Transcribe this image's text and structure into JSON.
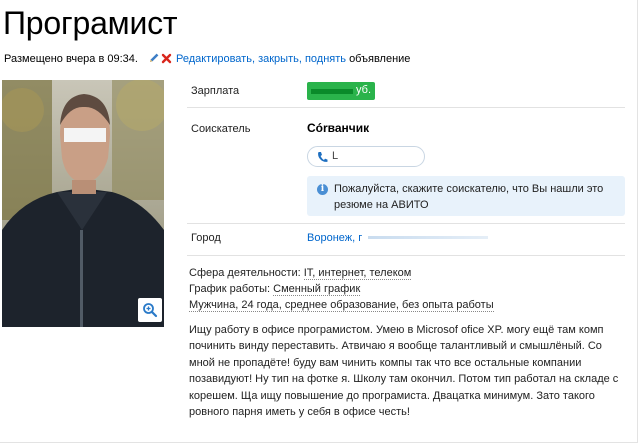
{
  "ad": {
    "title": "Програмист",
    "posted": "Размещено вчера в 09:34.",
    "actions": {
      "edit_close_raise": "Редактировать, закрыть, поднять",
      "object": "объявление"
    }
  },
  "fields": {
    "salary_label": "Зарплата",
    "salary_suffix": "уб.",
    "seeker_label": "Соискатель",
    "seeker_name": "Córванчик",
    "phone_partial": "L",
    "notice": "Пожалуйста, скажите соискателю, что Вы нашли это резюме на АВИТО",
    "city_label": "Город",
    "city_value": "Воронеж, г"
  },
  "details": {
    "sphere_label": "Сфера деятельности:",
    "sphere_value": "IT, интернет, телеком",
    "schedule_label": "График работы:",
    "schedule_value": "Сменный график",
    "person": "Мужчина, 24 года, среднее образование, без опыта работы"
  },
  "description": "Ищу работу в офисе програмистом. Умею в Microsof ofice XP. могу ещё там комп починить винду переставить. Атвичаю я вообще талантливый и смышлёный. Со мной не пропадёте! буду вам чинить компы так что все остальные компании позавидуют! Ну тип на фотке я. Школу там окончил. Потом тип работал на складе с корешем. Ща ищу повышение до програмиста. Двацатка минимум. Зато такого ровного парня иметь у себя в офисе честь!",
  "colors": {
    "link": "#0066cc",
    "salary_bg": "#2ab34b",
    "notice_bg": "#e8f2fb"
  },
  "icons": [
    "pencil-icon",
    "cross-icon",
    "zoom-icon",
    "phone-icon",
    "info-icon"
  ]
}
